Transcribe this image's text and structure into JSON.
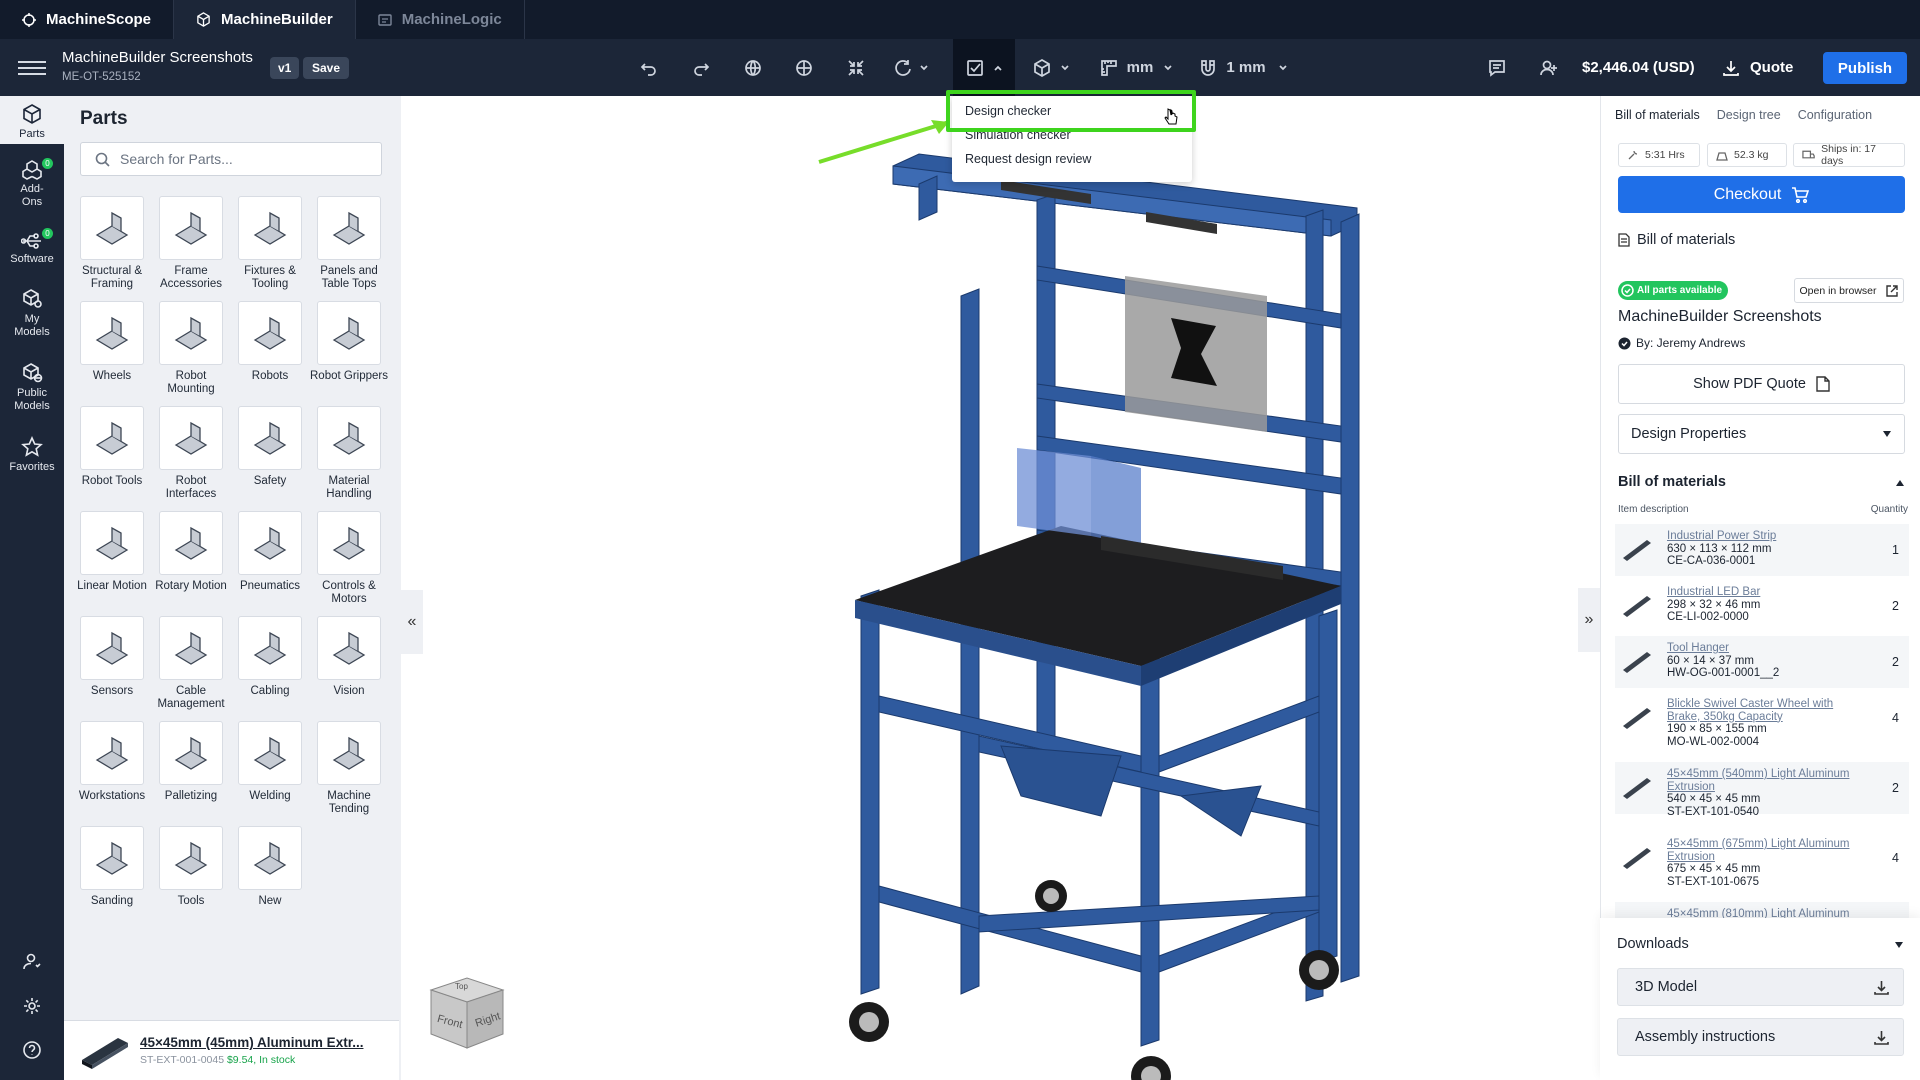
{
  "app_tabs": [
    {
      "label": "MachineScope",
      "icon": "machinescope-icon"
    },
    {
      "label": "MachineBuilder",
      "icon": "cube-icon"
    },
    {
      "label": "MachineLogic",
      "icon": "logic-icon"
    }
  ],
  "project": {
    "title": "MachineBuilder Screenshots",
    "id": "ME-OT-525152",
    "version": "v1",
    "save_label": "Save"
  },
  "toolbar": {
    "units": "mm",
    "snap": "1 mm",
    "price": "$2,446.04 (USD)",
    "quote_label": "Quote",
    "publish_label": "Publish"
  },
  "check_menu": {
    "items": [
      "Design checker",
      "Simulation checker",
      "Request design review"
    ],
    "highlighted": "Design checker",
    "highlight_color": "#3ed41d"
  },
  "rail": [
    {
      "label": "Parts",
      "icon": "parts-icon"
    },
    {
      "label": "Add-Ons",
      "icon": "addons-icon",
      "badge": "0"
    },
    {
      "label": "Software",
      "icon": "software-icon",
      "badge": "0"
    },
    {
      "label": "My Models",
      "icon": "my-models-icon"
    },
    {
      "label": "Public Models",
      "icon": "public-models-icon"
    },
    {
      "label": "Favorites",
      "icon": "star-icon"
    }
  ],
  "parts_panel": {
    "title": "Parts",
    "search_placeholder": "Search for Parts...",
    "categories": [
      "Structural & Framing",
      "Frame Accessories",
      "Fixtures & Tooling",
      "Panels and Table Tops",
      "Wheels",
      "Robot Mounting",
      "Robots",
      "Robot Grippers",
      "Robot Tools",
      "Robot Interfaces",
      "Safety",
      "Material Handling",
      "Linear Motion",
      "Rotary Motion",
      "Pneumatics",
      "Controls & Motors",
      "Sensors",
      "Cable Management",
      "Cabling",
      "Vision",
      "Workstations",
      "Palletizing",
      "Welding",
      "Machine Tending",
      "Sanding",
      "Tools",
      "New"
    ],
    "recent": {
      "name": "45×45mm (45mm) Aluminum Extr...",
      "sku": "ST-EXT-001-0045",
      "price": "$9.54",
      "stock": "In stock"
    }
  },
  "viewcube": {
    "top": "Top",
    "front": "Front",
    "right": "Right"
  },
  "right_panel": {
    "tabs": [
      "Bill of materials",
      "Design tree",
      "Configuration"
    ],
    "stats": {
      "time": "5:31 Hrs",
      "weight": "52.3 kg",
      "ships": "Ships in: 17 days"
    },
    "checkout_label": "Checkout",
    "bom_section_label": "Bill of materials",
    "availability": "All parts available",
    "open_browser": "Open in browser",
    "design_name": "MachineBuilder Screenshots",
    "author": "By: Jeremy Andrews",
    "pdf_quote": "Show PDF Quote",
    "design_properties": "Design Properties",
    "bom_header": "Bill of materials",
    "col_item": "Item description",
    "col_qty": "Quantity",
    "items": [
      {
        "name": "Industrial Power Strip",
        "dims": "630 × 113 × 112 mm",
        "sku": "CE-CA-036-0001",
        "qty": "1"
      },
      {
        "name": "Industrial LED Bar",
        "dims": "298 × 32 × 46 mm",
        "sku": "CE-LI-002-0000",
        "qty": "2"
      },
      {
        "name": "Tool Hanger",
        "dims": "60 × 14 × 37 mm",
        "sku": "HW-OG-001-0001__2",
        "qty": "2"
      },
      {
        "name": "Blickle Swivel Caster Wheel with Brake, 350kg Capacity",
        "dims": "190 × 85 × 155 mm",
        "sku": "MO-WL-002-0004",
        "qty": "4"
      },
      {
        "name": "45×45mm (540mm) Light Aluminum Extrusion",
        "dims": "540 × 45 × 45 mm",
        "sku": "ST-EXT-101-0540",
        "qty": "2"
      },
      {
        "name": "45×45mm (675mm) Light Aluminum Extrusion",
        "dims": "675 × 45 × 45 mm",
        "sku": "ST-EXT-101-0675",
        "qty": "4"
      },
      {
        "name": "45×45mm (810mm) Light Aluminum",
        "dims": "",
        "sku": "",
        "qty": ""
      }
    ],
    "downloads_label": "Downloads",
    "download_items": [
      "3D Model",
      "Assembly instructions"
    ]
  }
}
